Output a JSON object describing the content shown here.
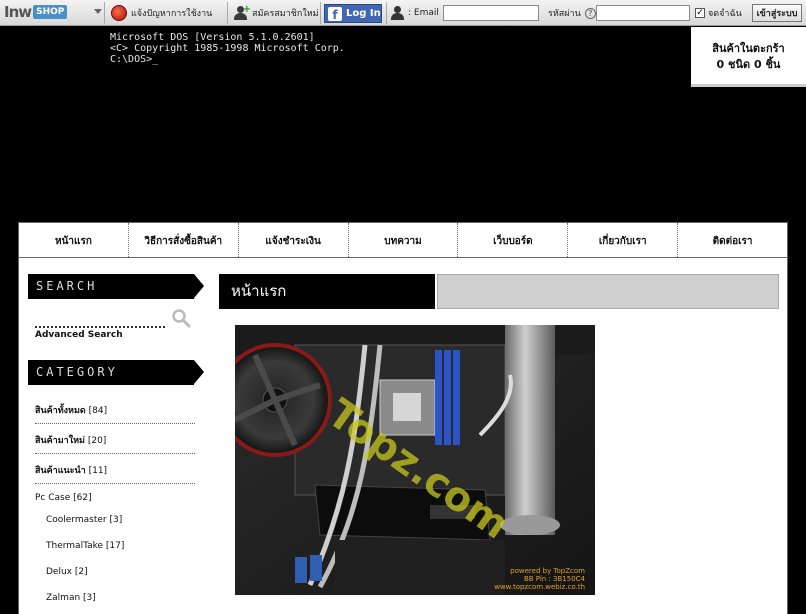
{
  "topbar": {
    "logo_inw": "Inw",
    "logo_shop": "SHOP",
    "report": "แจ้งปัญหาการใช้งาน",
    "register": "สมัครสมาชิกใหม่",
    "fb_login": "Log In",
    "email_label": ": Email",
    "email_value": "",
    "password_label": "รหัสผ่าน",
    "help": "?",
    "password_value": "",
    "remember": "จดจำฉัน",
    "remember_checked": "✓",
    "login": "เข้าสู่ระบบ"
  },
  "dos": {
    "line1": "Microsoft DOS [Version 5.1.0.2601]",
    "line2": "<C> Copyright 1985-1998 Microsoft Corp.",
    "line3": "",
    "prompt": "C:\\DOS>_"
  },
  "cart": {
    "title": "สินค้าในตะกร้า",
    "summary": "0 ชนิด 0 ชิ้น"
  },
  "nav": {
    "items": [
      {
        "label": "หน้าแรก"
      },
      {
        "label": "วิธีการสั่งซื้อสินค้า"
      },
      {
        "label": "แจ้งชำระเงิน"
      },
      {
        "label": "บทความ"
      },
      {
        "label": "เว็บบอร์ด"
      },
      {
        "label": "เกี่ยวกับเรา"
      },
      {
        "label": "ติดต่อเรา"
      }
    ]
  },
  "sidebar": {
    "search_title": "SEARCH",
    "advanced_search": "Advanced Search",
    "category_title": "CATEGORY",
    "categories": [
      {
        "name": "สินค้าทั้งหมด",
        "count": "[84]"
      },
      {
        "name": "สินค้ามาใหม่",
        "count": "[20]"
      },
      {
        "name": "สินค้าแนะนำ",
        "count": "[11]"
      },
      {
        "name": "Pc Case",
        "count": "[62]"
      },
      {
        "name": "Coolermaster",
        "count": "[3]"
      },
      {
        "name": "ThermalTake",
        "count": "[17]"
      },
      {
        "name": "Delux",
        "count": "[2]"
      },
      {
        "name": "Zalman",
        "count": "[3]"
      }
    ]
  },
  "main": {
    "title": "หน้าแรก",
    "photo": {
      "watermark": "Topz.com",
      "credit1": "powered by TopZcom",
      "credit2": "BB Pin : 3B150C4",
      "credit3": "www.topzcom.webiz.co.th"
    }
  },
  "colors": {
    "accent_blue": "#4a90c8",
    "facebook": "#4267b2",
    "watermark": "#c8c81e"
  }
}
